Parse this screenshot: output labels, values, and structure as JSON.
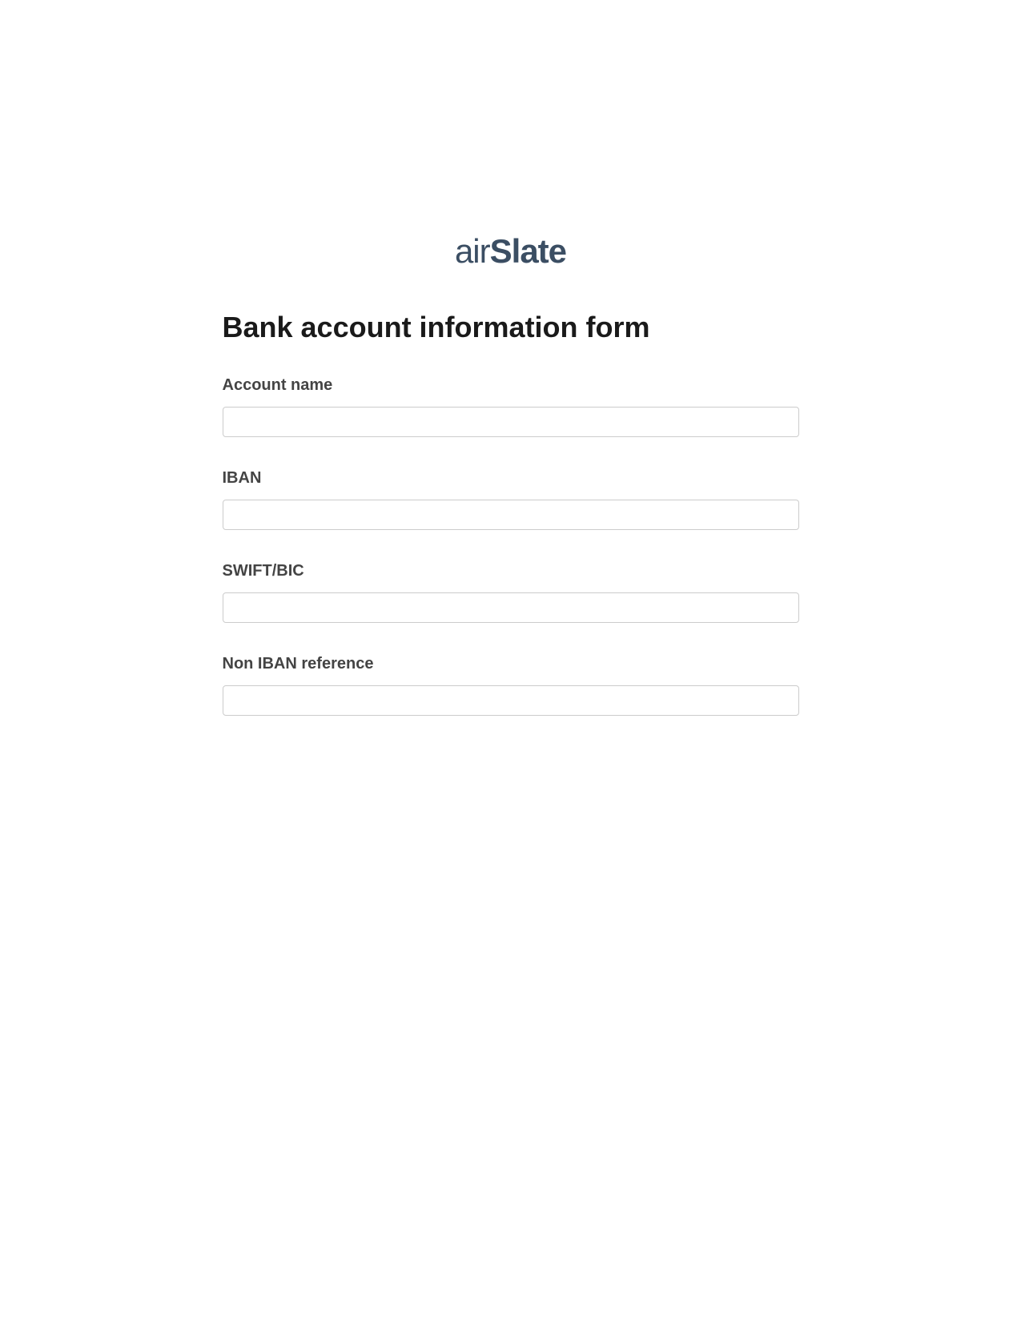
{
  "logo": {
    "part1": "air",
    "part2": "Slate"
  },
  "form": {
    "title": "Bank account information form",
    "fields": [
      {
        "label": "Account name",
        "value": ""
      },
      {
        "label": "IBAN",
        "value": ""
      },
      {
        "label": "SWIFT/BIC",
        "value": ""
      },
      {
        "label": "Non IBAN reference",
        "value": ""
      }
    ]
  }
}
